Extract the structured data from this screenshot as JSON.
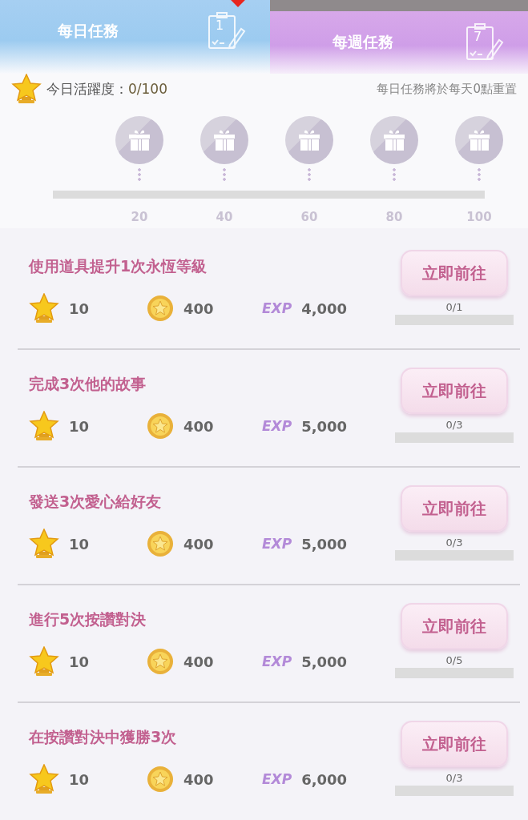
{
  "tabs": [
    {
      "label": "每日任務",
      "selected": true,
      "number": "1",
      "badge": true
    },
    {
      "label": "每週任務",
      "selected": false,
      "number": "7",
      "badge": false
    }
  ],
  "activity": {
    "label": "今日活躍度：",
    "value": "0/100",
    "note": "每日任務將於每天0點重置"
  },
  "milestones": {
    "level": 0,
    "points": [
      "20",
      "40",
      "60",
      "80",
      "100"
    ]
  },
  "tasks": [
    {
      "title": "使用道具提升1次永恆等級",
      "stars": "10",
      "coins": "400",
      "exp_label": "EXP",
      "exp": "4,000",
      "button": "立即前往",
      "progress": "0/1",
      "level": 0
    },
    {
      "title": "完成3次他的故事",
      "stars": "10",
      "coins": "400",
      "exp_label": "EXP",
      "exp": "5,000",
      "button": "立即前往",
      "progress": "0/3",
      "level": 0
    },
    {
      "title": "發送3次愛心給好友",
      "stars": "10",
      "coins": "400",
      "exp_label": "EXP",
      "exp": "5,000",
      "button": "立即前往",
      "progress": "0/3",
      "level": 0
    },
    {
      "title": "進行5次按讚對決",
      "stars": "10",
      "coins": "400",
      "exp_label": "EXP",
      "exp": "5,000",
      "button": "立即前往",
      "progress": "0/5",
      "level": 0
    },
    {
      "title": "在按讚對決中獲勝3次",
      "stars": "10",
      "coins": "400",
      "exp_label": "EXP",
      "exp": "6,000",
      "button": "立即前往",
      "progress": "0/3",
      "level": 0
    }
  ]
}
